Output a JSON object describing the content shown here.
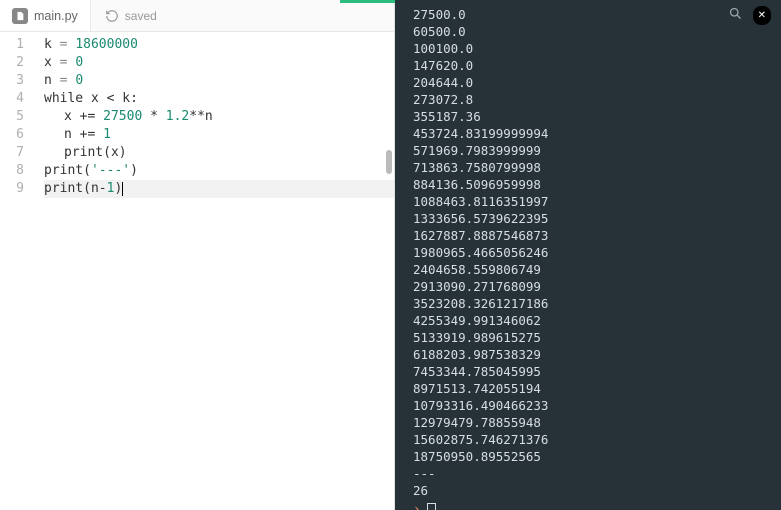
{
  "tab": {
    "filename": "main.py"
  },
  "status": {
    "saved_label": "saved"
  },
  "editor": {
    "gutter": [
      "1",
      "2",
      "3",
      "4",
      "5",
      "6",
      "7",
      "8",
      "9"
    ],
    "tokens": {
      "l1_kw": "k",
      "l1_eq": " = ",
      "l1_num": "18600000",
      "l2_kw": "x",
      "l2_eq": " = ",
      "l2_num": "0",
      "l3_kw": "n",
      "l3_eq": " = ",
      "l3_num": "0",
      "l4_while": "while ",
      "l4_cond": "x < k:",
      "l5_body": "x += ",
      "l5_n1": "27500",
      "l5_mid": " * ",
      "l5_n2": "1.2",
      "l5_pow": "**n",
      "l6_body": "n += ",
      "l6_n": "1",
      "l7_print": "print",
      "l7_arg": "(x)",
      "l8_print": "print",
      "l8_arg": "(",
      "l8_str": "'---'",
      "l8_close": ")",
      "l9_print": "print",
      "l9_arg": "(n-",
      "l9_n": "1",
      "l9_close": ")"
    }
  },
  "console": {
    "lines": [
      "27500.0",
      "60500.0",
      "100100.0",
      "147620.0",
      "204644.0",
      "273072.8",
      "355187.36",
      "453724.83199999994",
      "571969.7983999999",
      "713863.7580799998",
      "884136.5096959998",
      "1088463.8116351997",
      "1333656.5739622395",
      "1627887.8887546873",
      "1980965.4665056246",
      "2404658.559806749",
      "2913090.271768099",
      "3523208.3261217186",
      "4255349.991346062",
      "5133919.989615275",
      "6188203.987538329",
      "7453344.785045995",
      "8971513.742055194",
      "10793316.490466233",
      "12979479.78855948",
      "15602875.746271376",
      "18750950.89552565",
      "---",
      "26"
    ],
    "prompt": ""
  },
  "icons": {
    "badge_text": "✕"
  }
}
